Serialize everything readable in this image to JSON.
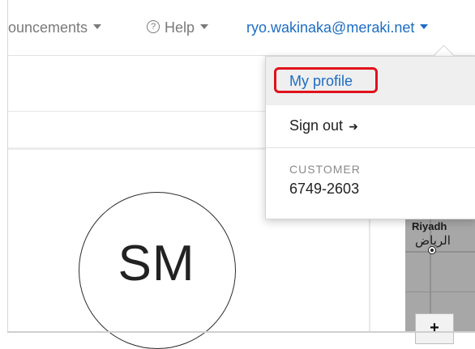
{
  "header": {
    "announcements_label": "ouncements",
    "help_label": "Help",
    "user_email": "ryo.wakinaka@meraki.net"
  },
  "dropdown": {
    "my_profile": "My profile",
    "sign_out": "Sign out",
    "customer_heading": "CUSTOMER",
    "customer_number": "6749-2603",
    "highlight_color": "#e0121a"
  },
  "profile": {
    "initials": "SM"
  },
  "map": {
    "city_en": "Riyadh",
    "city_ar": "الرياض",
    "zoom_in": "+"
  },
  "colors": {
    "link_blue": "#1d6dc2",
    "nav_gray": "#7a7a7a"
  }
}
